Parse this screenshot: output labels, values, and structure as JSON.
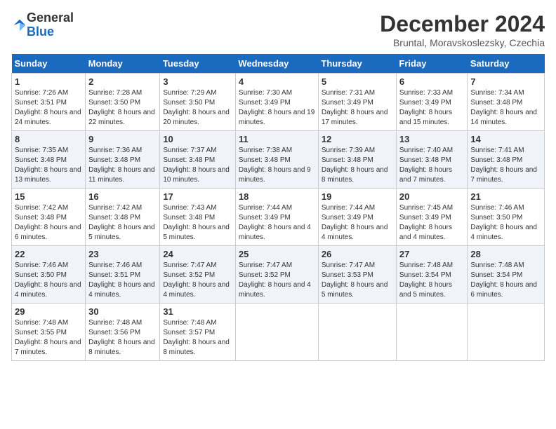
{
  "header": {
    "logo_line1": "General",
    "logo_line2": "Blue",
    "title": "December 2024",
    "subtitle": "Bruntal, Moravskoslezsky, Czechia"
  },
  "columns": [
    "Sunday",
    "Monday",
    "Tuesday",
    "Wednesday",
    "Thursday",
    "Friday",
    "Saturday"
  ],
  "weeks": [
    [
      {
        "day": "1",
        "sunrise": "7:26 AM",
        "sunset": "3:51 PM",
        "daylight": "8 hours and 24 minutes."
      },
      {
        "day": "2",
        "sunrise": "7:28 AM",
        "sunset": "3:50 PM",
        "daylight": "8 hours and 22 minutes."
      },
      {
        "day": "3",
        "sunrise": "7:29 AM",
        "sunset": "3:50 PM",
        "daylight": "8 hours and 20 minutes."
      },
      {
        "day": "4",
        "sunrise": "7:30 AM",
        "sunset": "3:49 PM",
        "daylight": "8 hours and 19 minutes."
      },
      {
        "day": "5",
        "sunrise": "7:31 AM",
        "sunset": "3:49 PM",
        "daylight": "8 hours and 17 minutes."
      },
      {
        "day": "6",
        "sunrise": "7:33 AM",
        "sunset": "3:49 PM",
        "daylight": "8 hours and 15 minutes."
      },
      {
        "day": "7",
        "sunrise": "7:34 AM",
        "sunset": "3:48 PM",
        "daylight": "8 hours and 14 minutes."
      }
    ],
    [
      {
        "day": "8",
        "sunrise": "7:35 AM",
        "sunset": "3:48 PM",
        "daylight": "8 hours and 13 minutes."
      },
      {
        "day": "9",
        "sunrise": "7:36 AM",
        "sunset": "3:48 PM",
        "daylight": "8 hours and 11 minutes."
      },
      {
        "day": "10",
        "sunrise": "7:37 AM",
        "sunset": "3:48 PM",
        "daylight": "8 hours and 10 minutes."
      },
      {
        "day": "11",
        "sunrise": "7:38 AM",
        "sunset": "3:48 PM",
        "daylight": "8 hours and 9 minutes."
      },
      {
        "day": "12",
        "sunrise": "7:39 AM",
        "sunset": "3:48 PM",
        "daylight": "8 hours and 8 minutes."
      },
      {
        "day": "13",
        "sunrise": "7:40 AM",
        "sunset": "3:48 PM",
        "daylight": "8 hours and 7 minutes."
      },
      {
        "day": "14",
        "sunrise": "7:41 AM",
        "sunset": "3:48 PM",
        "daylight": "8 hours and 7 minutes."
      }
    ],
    [
      {
        "day": "15",
        "sunrise": "7:42 AM",
        "sunset": "3:48 PM",
        "daylight": "8 hours and 6 minutes."
      },
      {
        "day": "16",
        "sunrise": "7:42 AM",
        "sunset": "3:48 PM",
        "daylight": "8 hours and 5 minutes."
      },
      {
        "day": "17",
        "sunrise": "7:43 AM",
        "sunset": "3:48 PM",
        "daylight": "8 hours and 5 minutes."
      },
      {
        "day": "18",
        "sunrise": "7:44 AM",
        "sunset": "3:49 PM",
        "daylight": "8 hours and 4 minutes."
      },
      {
        "day": "19",
        "sunrise": "7:44 AM",
        "sunset": "3:49 PM",
        "daylight": "8 hours and 4 minutes."
      },
      {
        "day": "20",
        "sunrise": "7:45 AM",
        "sunset": "3:49 PM",
        "daylight": "8 hours and 4 minutes."
      },
      {
        "day": "21",
        "sunrise": "7:46 AM",
        "sunset": "3:50 PM",
        "daylight": "8 hours and 4 minutes."
      }
    ],
    [
      {
        "day": "22",
        "sunrise": "7:46 AM",
        "sunset": "3:50 PM",
        "daylight": "8 hours and 4 minutes."
      },
      {
        "day": "23",
        "sunrise": "7:46 AM",
        "sunset": "3:51 PM",
        "daylight": "8 hours and 4 minutes."
      },
      {
        "day": "24",
        "sunrise": "7:47 AM",
        "sunset": "3:52 PM",
        "daylight": "8 hours and 4 minutes."
      },
      {
        "day": "25",
        "sunrise": "7:47 AM",
        "sunset": "3:52 PM",
        "daylight": "8 hours and 4 minutes."
      },
      {
        "day": "26",
        "sunrise": "7:47 AM",
        "sunset": "3:53 PM",
        "daylight": "8 hours and 5 minutes."
      },
      {
        "day": "27",
        "sunrise": "7:48 AM",
        "sunset": "3:54 PM",
        "daylight": "8 hours and 5 minutes."
      },
      {
        "day": "28",
        "sunrise": "7:48 AM",
        "sunset": "3:54 PM",
        "daylight": "8 hours and 6 minutes."
      }
    ],
    [
      {
        "day": "29",
        "sunrise": "7:48 AM",
        "sunset": "3:55 PM",
        "daylight": "8 hours and 7 minutes."
      },
      {
        "day": "30",
        "sunrise": "7:48 AM",
        "sunset": "3:56 PM",
        "daylight": "8 hours and 8 minutes."
      },
      {
        "day": "31",
        "sunrise": "7:48 AM",
        "sunset": "3:57 PM",
        "daylight": "8 hours and 8 minutes."
      },
      null,
      null,
      null,
      null
    ]
  ]
}
